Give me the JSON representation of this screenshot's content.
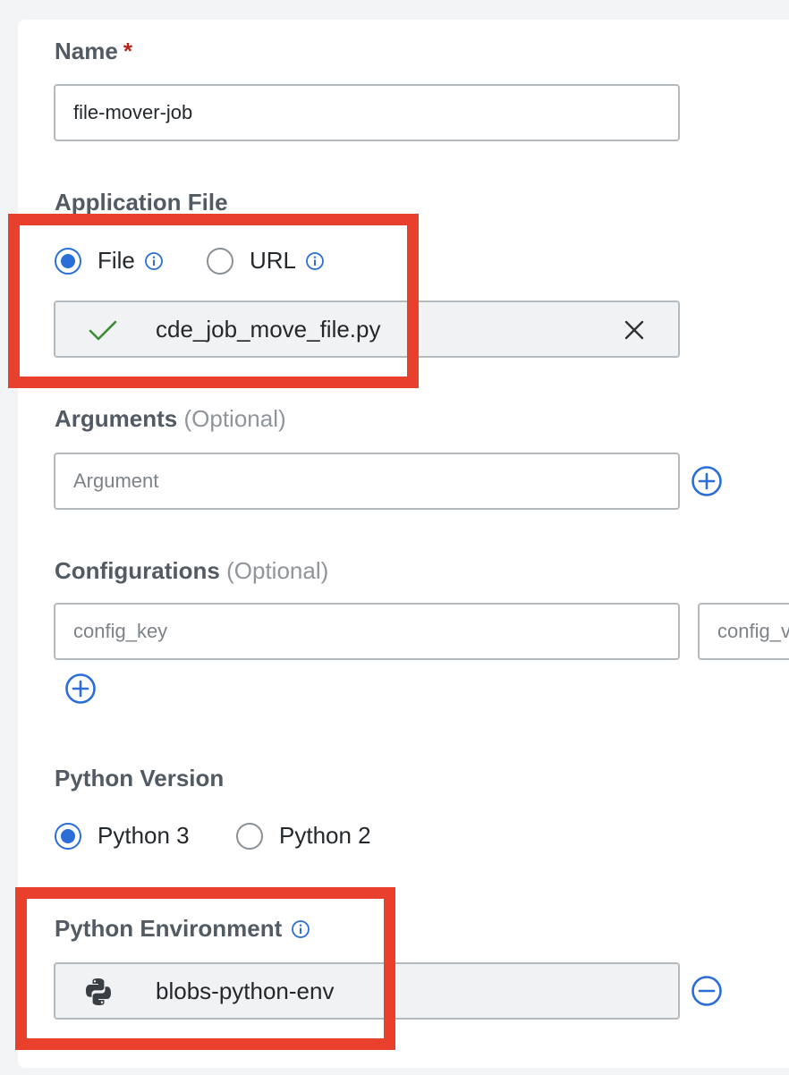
{
  "name_field": {
    "label": "Name",
    "required_mark": "*",
    "value": "file-mover-job"
  },
  "application_file": {
    "label": "Application File",
    "options": [
      {
        "label": "File",
        "checked": true,
        "icon": "info-icon"
      },
      {
        "label": "URL",
        "checked": false,
        "icon": "info-icon"
      }
    ],
    "uploaded_file": {
      "name": "cde_job_move_file.py",
      "status_icon": "check-icon",
      "remove_icon": "close-icon"
    }
  },
  "arguments": {
    "label": "Arguments",
    "optional_text": "(Optional)",
    "placeholder": "Argument",
    "add_icon": "plus-circle-icon"
  },
  "configurations": {
    "label": "Configurations",
    "optional_text": "(Optional)",
    "key_placeholder": "config_key",
    "value_placeholder": "config_v",
    "add_icon": "plus-circle-icon"
  },
  "python_version": {
    "label": "Python Version",
    "options": [
      {
        "label": "Python 3",
        "checked": true
      },
      {
        "label": "Python 2",
        "checked": false
      }
    ]
  },
  "python_environment": {
    "label": "Python Environment",
    "info_icon": "info-icon",
    "value": "blobs-python-env",
    "env_icon": "python-icon",
    "remove_icon": "minus-circle-icon"
  },
  "colors": {
    "accent": "#2b6ed7",
    "highlight": "#e8402d",
    "required": "#b3261e",
    "success": "#3d8b37"
  }
}
